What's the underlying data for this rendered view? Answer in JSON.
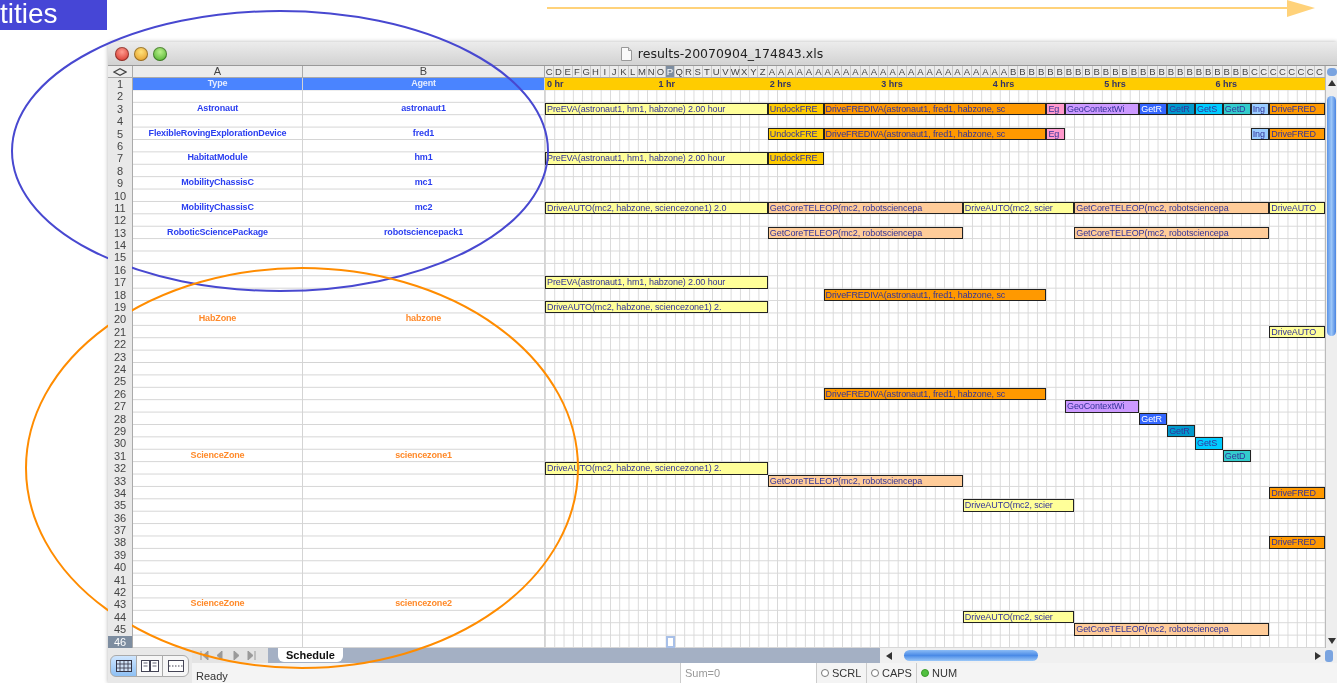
{
  "slide_label": {
    "text": "tities"
  },
  "window": {
    "title": "results-20070904_174843.xls"
  },
  "column_headers": [
    "A",
    "B"
  ],
  "gantt_columns": [
    {
      "label": "C",
      "selected": false
    },
    {
      "label": "D",
      "selected": false
    },
    {
      "label": "E",
      "selected": false
    },
    {
      "label": "F",
      "selected": false
    },
    {
      "label": "G",
      "selected": false
    },
    {
      "label": "H",
      "selected": false
    },
    {
      "label": "I",
      "selected": false
    },
    {
      "label": "J",
      "selected": false
    },
    {
      "label": "K",
      "selected": false
    },
    {
      "label": "L",
      "selected": false
    },
    {
      "label": "M",
      "selected": false
    },
    {
      "label": "N",
      "selected": false
    },
    {
      "label": "O",
      "selected": false
    },
    {
      "label": "P",
      "selected": true
    },
    {
      "label": "Q",
      "selected": false
    },
    {
      "label": "R",
      "selected": false
    },
    {
      "label": "S",
      "selected": false
    },
    {
      "label": "T",
      "selected": false
    },
    {
      "label": "U",
      "selected": false
    },
    {
      "label": "V",
      "selected": false
    },
    {
      "label": "W",
      "selected": false
    },
    {
      "label": "X",
      "selected": false
    },
    {
      "label": "Y",
      "selected": false
    },
    {
      "label": "Z",
      "selected": false
    },
    {
      "label": "A",
      "selected": false
    },
    {
      "label": "A",
      "selected": false
    },
    {
      "label": "A",
      "selected": false
    },
    {
      "label": "A",
      "selected": false
    },
    {
      "label": "A",
      "selected": false
    },
    {
      "label": "A",
      "selected": false
    },
    {
      "label": "A",
      "selected": false
    },
    {
      "label": "A",
      "selected": false
    },
    {
      "label": "A",
      "selected": false
    },
    {
      "label": "A",
      "selected": false
    },
    {
      "label": "A",
      "selected": false
    },
    {
      "label": "A",
      "selected": false
    },
    {
      "label": "A",
      "selected": false
    },
    {
      "label": "A",
      "selected": false
    },
    {
      "label": "A",
      "selected": false
    },
    {
      "label": "A",
      "selected": false
    },
    {
      "label": "A",
      "selected": false
    },
    {
      "label": "A",
      "selected": false
    },
    {
      "label": "A",
      "selected": false
    },
    {
      "label": "A",
      "selected": false
    },
    {
      "label": "A",
      "selected": false
    },
    {
      "label": "A",
      "selected": false
    },
    {
      "label": "A",
      "selected": false
    },
    {
      "label": "A",
      "selected": false
    },
    {
      "label": "A",
      "selected": false
    },
    {
      "label": "A",
      "selected": false
    },
    {
      "label": "B",
      "selected": false
    },
    {
      "label": "B",
      "selected": false
    },
    {
      "label": "B",
      "selected": false
    },
    {
      "label": "B",
      "selected": false
    },
    {
      "label": "B",
      "selected": false
    },
    {
      "label": "B",
      "selected": false
    },
    {
      "label": "B",
      "selected": false
    },
    {
      "label": "B",
      "selected": false
    },
    {
      "label": "B",
      "selected": false
    },
    {
      "label": "B",
      "selected": false
    },
    {
      "label": "B",
      "selected": false
    },
    {
      "label": "B",
      "selected": false
    },
    {
      "label": "B",
      "selected": false
    },
    {
      "label": "B",
      "selected": false
    },
    {
      "label": "B",
      "selected": false
    },
    {
      "label": "B",
      "selected": false
    },
    {
      "label": "B",
      "selected": false
    },
    {
      "label": "B",
      "selected": false
    },
    {
      "label": "B",
      "selected": false
    },
    {
      "label": "B",
      "selected": false
    },
    {
      "label": "B",
      "selected": false
    },
    {
      "label": "B",
      "selected": false
    },
    {
      "label": "B",
      "selected": false
    },
    {
      "label": "B",
      "selected": false
    },
    {
      "label": "B",
      "selected": false
    },
    {
      "label": "B",
      "selected": false
    },
    {
      "label": "C",
      "selected": false
    },
    {
      "label": "C",
      "selected": false
    },
    {
      "label": "C",
      "selected": false
    },
    {
      "label": "C",
      "selected": false
    },
    {
      "label": "C",
      "selected": false
    },
    {
      "label": "C",
      "selected": false
    },
    {
      "label": "C",
      "selected": false
    },
    {
      "label": "C",
      "selected": false
    }
  ],
  "timeline": {
    "hours": [
      "0 hr",
      "1 hr",
      "2 hrs",
      "3 hrs",
      "4 hrs",
      "5 hrs",
      "6 hrs"
    ]
  },
  "rows": [
    {
      "number": "1",
      "selected": false,
      "kind": "header",
      "type": "Type",
      "agent": "Agent"
    },
    {
      "number": "2",
      "selected": false,
      "kind": "empty"
    },
    {
      "number": "3",
      "selected": false,
      "kind": "agent",
      "type": "Astronaut",
      "agent": "astronaut1",
      "bars": [
        {
          "label": "PreEVA(astronaut1, hm1, habzone) 2.00 hour",
          "color": "#ffff99"
        },
        {
          "label": "UndockFRE",
          "color": "#ffcc00"
        },
        {
          "label": "DriveFREDIVA(astronaut1, fred1, habzone, sc",
          "color": "#ff9900"
        },
        {
          "label": "Eg",
          "color": "#ff99cc"
        },
        {
          "label": "GeoContextWi",
          "color": "#cc99ff"
        },
        {
          "label": "GetR",
          "color": "#3366ff"
        },
        {
          "label": "GetR",
          "color": "#0099cc"
        },
        {
          "label": "GetS",
          "color": "#00ccff"
        },
        {
          "label": "GetD",
          "color": "#33cccc"
        },
        {
          "label": "Ing",
          "color": "#99ccff"
        },
        {
          "label": "DriveFRED",
          "color": "#ff9900"
        }
      ]
    },
    {
      "number": "4",
      "selected": false,
      "kind": "empty"
    },
    {
      "number": "5",
      "selected": false,
      "kind": "agent",
      "type": "FlexibleRovingExplorationDevice",
      "agent": "fred1",
      "bars": [
        {
          "label": "UndockFRE",
          "color": "#ffcc00"
        },
        {
          "label": "DriveFREDIVA(astronaut1, fred1, habzone, sc",
          "color": "#ff9900"
        },
        {
          "label": "Eg",
          "color": "#ff99cc"
        },
        {
          "label": "Ing",
          "color": "#99ccff"
        },
        {
          "label": "DriveFRED",
          "color": "#ff9900"
        }
      ]
    },
    {
      "number": "6",
      "selected": false,
      "kind": "empty"
    },
    {
      "number": "7",
      "selected": false,
      "kind": "agent",
      "type": "HabitatModule",
      "agent": "hm1",
      "bars": [
        {
          "label": "PreEVA(astronaut1, hm1, habzone) 2.00 hour",
          "color": "#ffff99"
        },
        {
          "label": "UndockFRE",
          "color": "#ffcc00"
        }
      ]
    },
    {
      "number": "8",
      "selected": false,
      "kind": "empty"
    },
    {
      "number": "9",
      "selected": false,
      "kind": "agent",
      "type": "MobilityChassisC",
      "agent": "mc1"
    },
    {
      "number": "10",
      "selected": false,
      "kind": "empty"
    },
    {
      "number": "11",
      "selected": false,
      "kind": "agent",
      "type": "MobilityChassisC",
      "agent": "mc2",
      "bars": [
        {
          "label": "DriveAUTO(mc2, habzone, sciencezone1) 2.0",
          "color": "#ffff99"
        },
        {
          "label": "GetCoreTELEOP(mc2, robotsciencepa",
          "color": "#ffcc99"
        },
        {
          "label": "DriveAUTO(mc2, scier",
          "color": "#ffff99"
        },
        {
          "label": "GetCoreTELEOP(mc2, robotsciencepa",
          "color": "#ffcc99"
        },
        {
          "label": "DriveAUTO",
          "color": "#ffff99"
        }
      ]
    },
    {
      "number": "12",
      "selected": false,
      "kind": "empty"
    },
    {
      "number": "13",
      "selected": false,
      "kind": "agent",
      "type": "RoboticSciencePackage",
      "agent": "robotsciencepack1",
      "bars": [
        {
          "label": "GetCoreTELEOP(mc2, robotsciencepa",
          "color": "#ffcc99"
        },
        {
          "label": "GetCoreTELEOP(mc2, robotsciencepa",
          "color": "#ffcc99"
        }
      ]
    },
    {
      "number": "14",
      "selected": false,
      "kind": "empty"
    },
    {
      "number": "15",
      "selected": false,
      "kind": "empty"
    },
    {
      "number": "16",
      "selected": false,
      "kind": "empty"
    },
    {
      "number": "17",
      "selected": false,
      "kind": "empty",
      "bars": [
        {
          "label": "PreEVA(astronaut1, hm1, habzone) 2.00 hour",
          "color": "#ffff99"
        }
      ]
    },
    {
      "number": "18",
      "selected": false,
      "kind": "empty",
      "bars": [
        {
          "label": "DriveFREDIVA(astronaut1, fred1, habzone, sc",
          "color": "#ff9900"
        }
      ]
    },
    {
      "number": "19",
      "selected": false,
      "kind": "empty",
      "bars": [
        {
          "label": "DriveAUTO(mc2, habzone, sciencezone1) 2.",
          "color": "#ffff99"
        }
      ]
    },
    {
      "number": "20",
      "selected": false,
      "kind": "zone",
      "type": "HabZone",
      "agent": "habzone"
    },
    {
      "number": "21",
      "selected": false,
      "kind": "empty",
      "bars": [
        {
          "label": "DriveAUTO",
          "color": "#ffff99"
        }
      ]
    },
    {
      "number": "22",
      "selected": false,
      "kind": "empty"
    },
    {
      "number": "23",
      "selected": false,
      "kind": "empty"
    },
    {
      "number": "24",
      "selected": false,
      "kind": "empty"
    },
    {
      "number": "25",
      "selected": false,
      "kind": "empty"
    },
    {
      "number": "26",
      "selected": false,
      "kind": "empty",
      "bars": [
        {
          "label": "DriveFREDIVA(astronaut1, fred1, habzone, sc",
          "color": "#ff9900"
        }
      ]
    },
    {
      "number": "27",
      "selected": false,
      "kind": "empty",
      "bars": [
        {
          "label": "GeoContextWi",
          "color": "#cc99ff"
        }
      ]
    },
    {
      "number": "28",
      "selected": false,
      "kind": "empty",
      "bars": [
        {
          "label": "GetR",
          "color": "#3366ff"
        }
      ]
    },
    {
      "number": "29",
      "selected": false,
      "kind": "empty",
      "bars": [
        {
          "label": "GetR",
          "color": "#0099cc"
        }
      ]
    },
    {
      "number": "30",
      "selected": false,
      "kind": "empty",
      "bars": [
        {
          "label": "GetS",
          "color": "#00ccff"
        }
      ]
    },
    {
      "number": "31",
      "selected": false,
      "kind": "zone",
      "type": "ScienceZone",
      "agent": "sciencezone1",
      "bars": [
        {
          "label": "GetD",
          "color": "#33cccc"
        }
      ]
    },
    {
      "number": "32",
      "selected": false,
      "kind": "empty",
      "bars": [
        {
          "label": "DriveAUTO(mc2, habzone, sciencezone1) 2.",
          "color": "#ffff99"
        }
      ]
    },
    {
      "number": "33",
      "selected": false,
      "kind": "empty",
      "bars": [
        {
          "label": "GetCoreTELEOP(mc2, robotsciencepa",
          "color": "#ffcc99"
        }
      ]
    },
    {
      "number": "34",
      "selected": false,
      "kind": "empty",
      "bars": [
        {
          "label": "DriveFRED",
          "color": "#ff9900"
        }
      ]
    },
    {
      "number": "35",
      "selected": false,
      "kind": "empty",
      "bars": [
        {
          "label": "DriveAUTO(mc2, scier",
          "color": "#ffff99"
        }
      ]
    },
    {
      "number": "36",
      "selected": false,
      "kind": "empty"
    },
    {
      "number": "37",
      "selected": false,
      "kind": "empty"
    },
    {
      "number": "38",
      "selected": false,
      "kind": "empty",
      "bars": [
        {
          "label": "DriveFRED",
          "color": "#ff9900"
        }
      ]
    },
    {
      "number": "39",
      "selected": false,
      "kind": "empty"
    },
    {
      "number": "40",
      "selected": false,
      "kind": "empty"
    },
    {
      "number": "41",
      "selected": false,
      "kind": "empty"
    },
    {
      "number": "42",
      "selected": false,
      "kind": "empty"
    },
    {
      "number": "43",
      "selected": false,
      "kind": "zone",
      "type": "ScienceZone",
      "agent": "sciencezone2"
    },
    {
      "number": "44",
      "selected": false,
      "kind": "empty",
      "bars": [
        {
          "label": "DriveAUTO(mc2, scier",
          "color": "#ffff99"
        }
      ]
    },
    {
      "number": "45",
      "selected": false,
      "kind": "empty",
      "bars": [
        {
          "label": "GetCoreTELEOP(mc2, robotsciencepa",
          "color": "#ffcc99"
        }
      ]
    },
    {
      "number": "46",
      "selected": true,
      "kind": "empty"
    }
  ],
  "view_buttons": [
    {
      "kind": "normal",
      "selected": true
    },
    {
      "kind": "layout",
      "selected": false
    },
    {
      "kind": "page-break",
      "selected": false
    }
  ],
  "sheet_tabs": [
    {
      "label": "Schedule",
      "selected": true
    }
  ],
  "status_bar": {
    "status": "Ready",
    "sum": "Sum=0",
    "indicators": [
      {
        "label": "SCRL",
        "on": false
      },
      {
        "label": "CAPS",
        "on": false
      },
      {
        "label": "NUM",
        "on": true
      }
    ]
  }
}
